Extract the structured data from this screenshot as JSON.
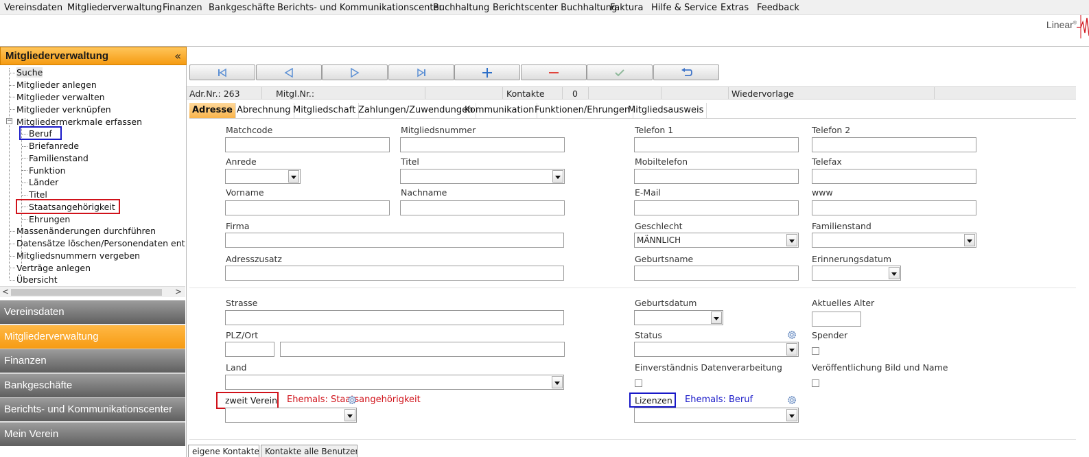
{
  "menubar": {
    "items": [
      "Vereinsdaten",
      "Mitgliederverwaltung",
      "Finanzen",
      "Bankgeschäfte",
      "Berichts- und Kommunikationscenter",
      "Buchhaltung",
      "Berichtscenter Buchhaltung",
      "Faktura",
      "Hilfe & Service",
      "Extras",
      "Feedback"
    ]
  },
  "logo": {
    "text": "Linear",
    "mark": "®"
  },
  "leftpanel": {
    "title": "Mitgliederverwaltung",
    "collapse": "«",
    "tree": [
      "Suche",
      "Mitglieder anlegen",
      "Mitglieder verwalten",
      "Mitglieder verknüpfen",
      "Mitgliedermerkmale erfassen",
      "Beruf",
      "Briefanrede",
      "Familienstand",
      "Funktion",
      "Länder",
      "Titel",
      "Staatsangehörigkeit",
      "Ehrungen",
      "Massenänderungen durchführen",
      "Datensätze löschen/Personendaten entfern",
      "Mitgliedsnummern vergeben",
      "Verträge anlegen",
      "Übersicht"
    ],
    "expander": "−",
    "scroll_left": "<",
    "scroll_right": ">",
    "nav": [
      "Vereinsdaten",
      "Mitgliederverwaltung",
      "Finanzen",
      "Bankgeschäfte",
      "Berichts- und Kommunikationscenter",
      "Mein Verein"
    ]
  },
  "toolbar": [
    "first-icon",
    "prev-icon",
    "next-icon",
    "last-icon",
    "add-icon",
    "delete-icon",
    "check-icon",
    "undo-icon"
  ],
  "infobar": {
    "adrnr": "Adr.Nr.: 263",
    "mitglnr": "Mitgl.Nr.:",
    "kontakte_label": "Kontakte",
    "kontakte_value": "0",
    "wiedervorlage": "Wiedervorlage"
  },
  "tabs": [
    "Adresse",
    "Abrechnung",
    "Mitgliedschaft",
    "Zahlungen/Zuwendungen",
    "Kommunikation",
    "Funktionen/Ehrungen",
    "Mitgliedsausweis"
  ],
  "form": {
    "matchcode": "Matchcode",
    "mitgliedsnummer": "Mitgliedsnummer",
    "telefon1": "Telefon 1",
    "telefon2": "Telefon 2",
    "anrede": "Anrede",
    "titel": "Titel",
    "mobiltelefon": "Mobiltelefon",
    "telefax": "Telefax",
    "vorname": "Vorname",
    "nachname": "Nachname",
    "email": "E-Mail",
    "www": "www",
    "firma": "Firma",
    "geschlecht": "Geschlecht",
    "geschlecht_value": "MÄNNLICH",
    "familienstand": "Familienstand",
    "adresszusatz": "Adresszusatz",
    "geburtsname": "Geburtsname",
    "erinnerungsdatum": "Erinnerungsdatum",
    "strasse": "Strasse",
    "geburtsdatum": "Geburtsdatum",
    "alter": "Aktuelles Alter",
    "plzort": "PLZ/Ort",
    "status": "Status",
    "spender": "Spender",
    "land": "Land",
    "einverstaendnis": "Einverständnis Datenverarbeitung",
    "veroeffentlichung": "Veröffentlichung Bild und Name",
    "zweitverein": "zweit Verein",
    "lizenzen": "Lizenzen"
  },
  "annotations": {
    "red": "Ehemals: Staatsangehörigkeit",
    "blue": "Ehemals: Beruf",
    "red_color": "#d0121a",
    "blue_color": "#1818c8"
  },
  "bottom_tabs": [
    "eigene Kontakte",
    "Kontakte alle Benutzer"
  ]
}
